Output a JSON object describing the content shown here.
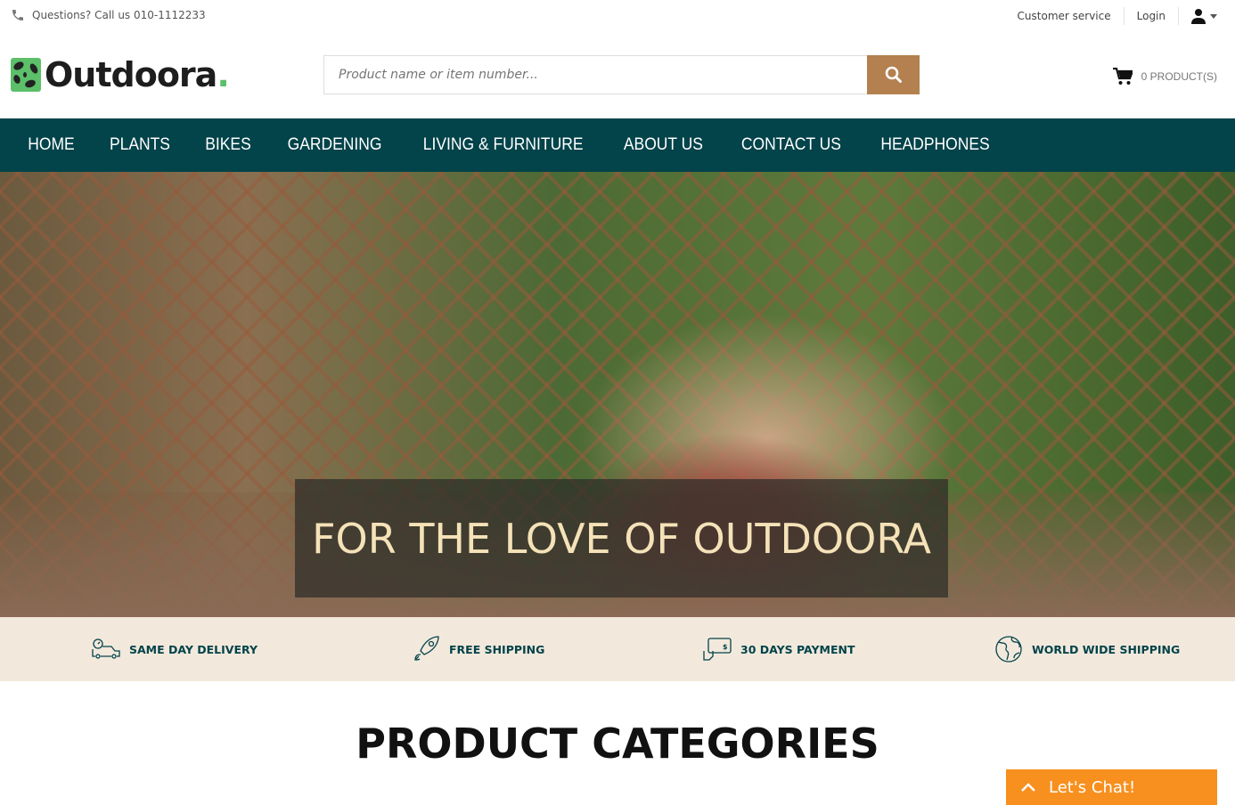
{
  "topbar": {
    "phone_text": "Questions? Call us 010-1112233",
    "customer_service": "Customer service",
    "login": "Login"
  },
  "header": {
    "logo_text": "Outdoora",
    "logo_dot": ".",
    "search_placeholder": "Product name or item number...",
    "cart_label": "0 PRODUCT(S)"
  },
  "nav": {
    "items": [
      "HOME",
      "PLANTS",
      "BIKES",
      "GARDENING",
      "LIVING & FURNITURE",
      "ABOUT US",
      "CONTACT US",
      "HEADPHONES"
    ]
  },
  "hero": {
    "title": "FOR THE LOVE OF OUTDOORA"
  },
  "features": [
    {
      "label": "SAME DAY DELIVERY",
      "icon": "delivery-truck-icon"
    },
    {
      "label": "FREE SHIPPING",
      "icon": "rocket-icon"
    },
    {
      "label": "30 DAYS PAYMENT",
      "icon": "payment-icon"
    },
    {
      "label": "WORLD WIDE SHIPPING",
      "icon": "globe-icon"
    }
  ],
  "section": {
    "title": "PRODUCT CATEGORIES"
  },
  "chat": {
    "label": "Let's Chat!"
  },
  "colors": {
    "nav_bg": "#03434a",
    "search_button": "#b4804f",
    "features_bg": "#f2e9dc",
    "chat_bg": "#f7901e",
    "logo_green": "#5cbf6a"
  }
}
